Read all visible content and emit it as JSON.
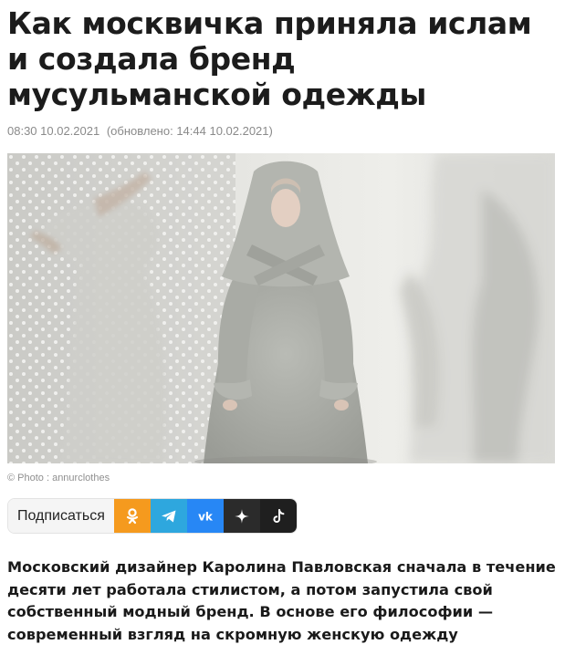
{
  "article": {
    "title": "Как москвичка приняла ислам и создала бренд мусульманской одежды",
    "published": "08:30 10.02.2021",
    "updated": "(обновлено: 14:44 10.02.2021)",
    "photo_credit": "© Photo : annurclothes",
    "lead": "Московский дизайнер Каролина Павловская сначала в течение десяти лет работала стилистом, а потом запустила свой собственный модный бренд. В основе его философии — современный взгляд на скромную женскую одежду"
  },
  "subscribe": {
    "label": "Подписаться",
    "networks": [
      {
        "name": "odnoklassniki",
        "icon": "odnoklassniki-icon",
        "color": "#f59a1e"
      },
      {
        "name": "telegram",
        "icon": "telegram-icon",
        "color": "#2ea7de"
      },
      {
        "name": "vk",
        "icon": "vk-icon",
        "color": "#2787f5"
      },
      {
        "name": "dzen",
        "icon": "dzen-icon",
        "color": "#2b2b2b"
      },
      {
        "name": "tiktok",
        "icon": "tiktok-icon",
        "color": "#1f1f1f"
      }
    ]
  }
}
